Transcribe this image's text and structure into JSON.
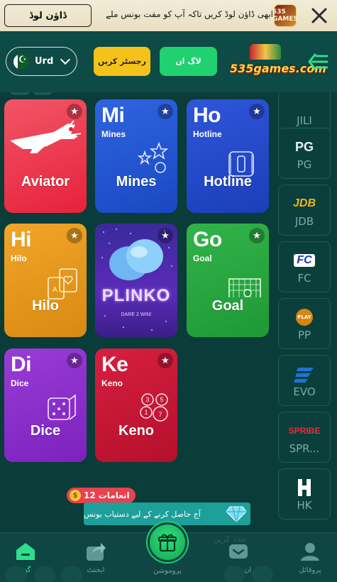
{
  "banner": {
    "download_label": "ڈاؤن لوڈ",
    "message": "ابھی ڈاؤن لوڈ کریں تاکہ آپ کو مفت بونس ملے",
    "app_icon_text": "535 GAMES"
  },
  "header": {
    "language_label": "Urd",
    "register_label": "رجسٹر کریں",
    "login_label": "لاگ ان",
    "logo_text": "535games.com"
  },
  "games": [
    {
      "abbr": "",
      "sub": "",
      "name": "Aviator"
    },
    {
      "abbr": "Mi",
      "sub": "Mines",
      "name": "Mines"
    },
    {
      "abbr": "Ho",
      "sub": "Hotline",
      "name": "Hotline"
    },
    {
      "abbr": "Hi",
      "sub": "Hilo",
      "name": "Hilo"
    },
    {
      "abbr": "",
      "sub": "",
      "name": "PLINKO",
      "tagline": "DARE 2 WIN!"
    },
    {
      "abbr": "Go",
      "sub": "Goal",
      "name": "Goal"
    },
    {
      "abbr": "Di",
      "sub": "Dice",
      "name": "Dice"
    },
    {
      "abbr": "Ke",
      "sub": "Keno",
      "name": "Keno"
    }
  ],
  "providers": [
    {
      "label": "JILI",
      "logo": ""
    },
    {
      "label": "PG",
      "logo": "PG"
    },
    {
      "label": "JDB",
      "logo": "JDB"
    },
    {
      "label": "FC",
      "logo": "FC"
    },
    {
      "label": "PP",
      "logo": "PLAY"
    },
    {
      "label": "EVO",
      "logo": ""
    },
    {
      "label": "SPR...",
      "logo": "SPRIBE"
    },
    {
      "label": "HK",
      "logo": ""
    }
  ],
  "promo": {
    "badge_label": "انعامات",
    "badge_count": "12",
    "bonus_text": "آج حاصل کرنے کے لیے دستیاب بونس"
  },
  "faded_text": "مدد کریں",
  "nav": {
    "home": "گھر",
    "agent": "ایجنٹ",
    "promotion": "پروموشن",
    "inbox": "ان باکس",
    "profile": "پروفائل"
  },
  "colors": {
    "background": "#0a3c39",
    "accent_green": "#1fd16f",
    "accent_yellow": "#f4c21b",
    "promo_red": "#e8414f"
  }
}
